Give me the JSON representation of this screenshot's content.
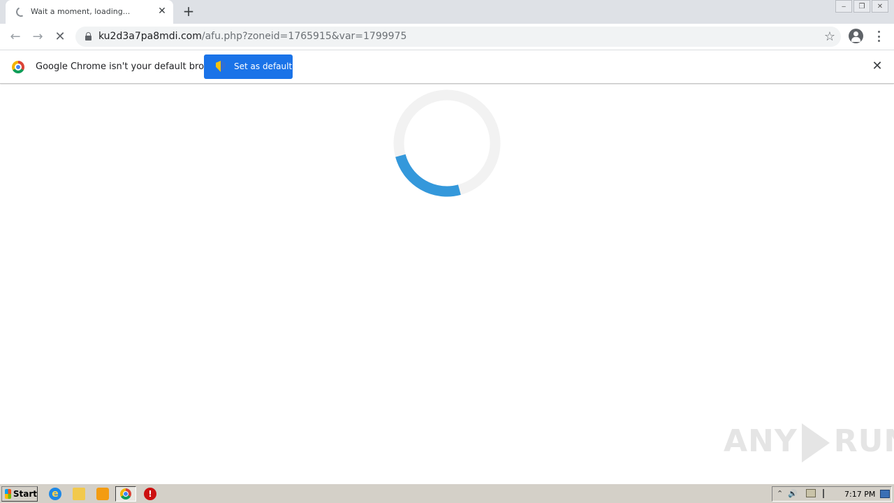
{
  "tab": {
    "title": "Wait a moment, loading...",
    "close_glyph": "✕",
    "new_tab_glyph": "+"
  },
  "window_controls": {
    "minimize": "‒",
    "restore": "❐",
    "close": "✕"
  },
  "toolbar": {
    "back_glyph": "←",
    "forward_glyph": "→",
    "stop_glyph": "✕",
    "url_host": "ku2d3a7pa8mdi.com",
    "url_path": "/afu.php?zoneid=1765915&var=1799975",
    "star_glyph": "☆"
  },
  "infobar": {
    "message": "Google Chrome isn't your default browser",
    "button_label": "Set as default",
    "close_glyph": "✕"
  },
  "loader": {
    "progress": 0.25,
    "track_color": "#f2f2f2",
    "arc_color": "#3498db"
  },
  "watermark": {
    "left": "ANY",
    "right": "RUN"
  },
  "taskbar": {
    "start_label": "Start",
    "ie_glyph": "e",
    "stop_glyph": "!",
    "tray_up": "⌃",
    "tray_volume": "🔊",
    "clock": "7:17 PM"
  },
  "colors": {
    "tabstrip": "#dee1e6",
    "accent_button": "#1a73e8"
  }
}
